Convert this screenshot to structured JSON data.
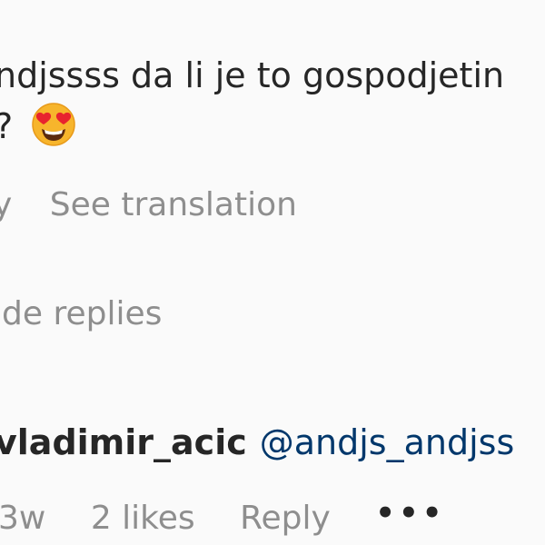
{
  "parent_comment": {
    "line1": "ndjssss da li je to gospodjetin",
    "line2": "?",
    "emoji": "heart-eyes-face"
  },
  "parent_meta": {
    "partial_reply": "y",
    "see_translation": "See translation"
  },
  "thread": {
    "hide_replies": "ide replies"
  },
  "reply": {
    "username": "vladimir_acic",
    "mention": "@andjs_andjss",
    "time": "3w",
    "likes": "2 likes",
    "reply_label": "Reply",
    "more": "•••"
  }
}
